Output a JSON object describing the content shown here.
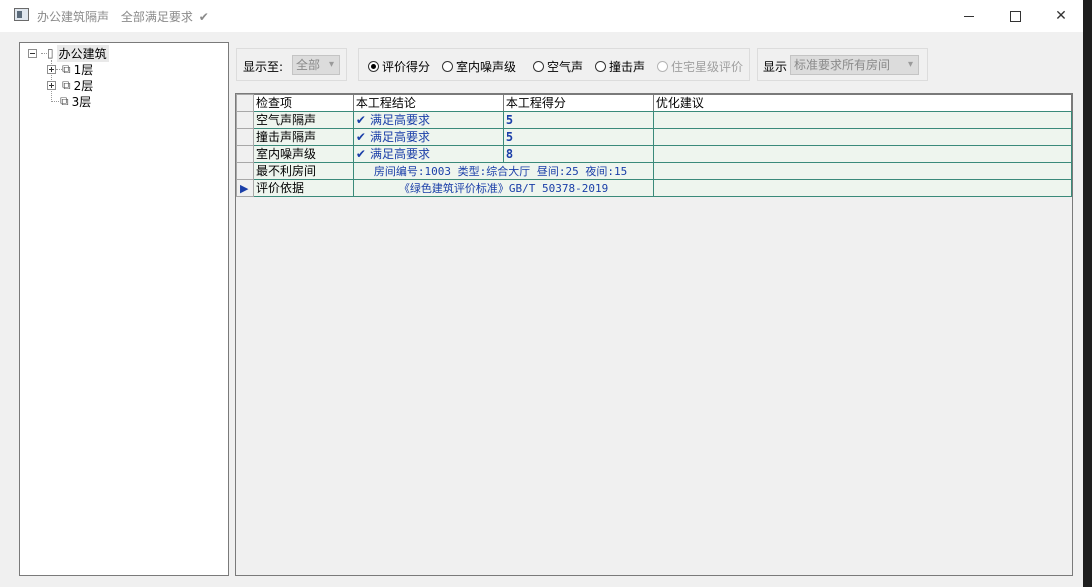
{
  "titlebar": {
    "title": "办公建筑隔声",
    "status": "全部满足要求",
    "status_check": "✔",
    "minimize_icon": "minimize-icon",
    "maximize_icon": "maximize-icon",
    "close_icon": "close-icon",
    "close_glyph": "✕"
  },
  "tree": {
    "root": {
      "label": "办公建筑",
      "icon": "building-icon",
      "expander": "⊟"
    },
    "floors": [
      {
        "label": "1层",
        "expandable": true
      },
      {
        "label": "2层",
        "expandable": true
      },
      {
        "label": "3层",
        "expandable": false
      }
    ]
  },
  "toolbar": {
    "show_to_label": "显示至:",
    "show_to_value": "全部",
    "radios": [
      {
        "label": "评价得分",
        "checked": true,
        "disabled": false
      },
      {
        "label": "室内噪声级",
        "checked": false,
        "disabled": false
      },
      {
        "label": "空气声",
        "checked": false,
        "disabled": false
      },
      {
        "label": "撞击声",
        "checked": false,
        "disabled": false
      },
      {
        "label": "住宅星级评价",
        "checked": false,
        "disabled": true
      }
    ],
    "display_label": "显示",
    "display_value": "标准要求所有房间"
  },
  "grid": {
    "columns": [
      "检查项",
      "本工程结论",
      "本工程得分",
      "优化建议"
    ],
    "rows": [
      {
        "item": "空气声隔声",
        "conclusion": "满足高要求",
        "check": "✔",
        "score": "5",
        "advice": ""
      },
      {
        "item": "撞击声隔声",
        "conclusion": "满足高要求",
        "check": "✔",
        "score": "5",
        "advice": ""
      },
      {
        "item": "室内噪声级",
        "conclusion": "满足高要求",
        "check": "✔",
        "score": "8",
        "advice": ""
      }
    ],
    "worst_room": {
      "item": "最不利房间",
      "text": "房间编号:1003 类型:综合大厅 昼间:25 夜间:15"
    },
    "basis": {
      "item": "评价依据",
      "text": "《绿色建筑评价标准》GB/T 50378-2019",
      "pointer": "▶"
    }
  },
  "colors": {
    "accent": "#1a3ea8",
    "grid_line": "#3a8a7a",
    "row_bg": "#eef5ee",
    "window_bg": "#f0f0f0"
  }
}
